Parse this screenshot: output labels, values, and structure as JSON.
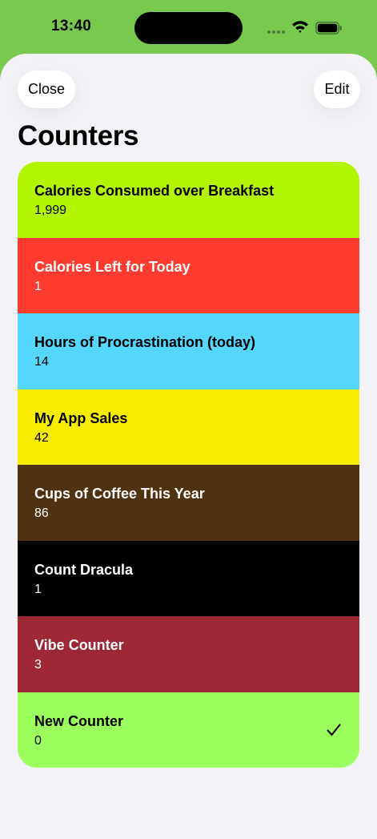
{
  "status_bar": {
    "time": "13:40"
  },
  "nav": {
    "close_label": "Close",
    "edit_label": "Edit"
  },
  "page_title": "Counters",
  "counters": [
    {
      "name": "Calories Consumed over Breakfast",
      "value": "1,999",
      "color": "#b2f500",
      "text_color": "#000000",
      "selected": false
    },
    {
      "name": "Calories Left for Today",
      "value": "1",
      "color": "#ff3b30",
      "text_color": "#ffffff",
      "selected": false
    },
    {
      "name": "Hours of Procrastination (today)",
      "value": "14",
      "color": "#55d6fc",
      "text_color": "#000000",
      "selected": false
    },
    {
      "name": "My App Sales",
      "value": "42",
      "color": "#f8ec00",
      "text_color": "#000000",
      "selected": false
    },
    {
      "name": "Cups of Coffee This Year",
      "value": "86",
      "color": "#4f3212",
      "text_color": "#ffffff",
      "selected": false
    },
    {
      "name": "Count Dracula",
      "value": "1",
      "color": "#000000",
      "text_color": "#ffffff",
      "selected": false
    },
    {
      "name": "Vibe Counter",
      "value": "3",
      "color": "#9e2835",
      "text_color": "#ffffff",
      "selected": false
    },
    {
      "name": "New Counter",
      "value": "0",
      "color": "#9bff5d",
      "text_color": "#000000",
      "selected": true
    }
  ],
  "colors": {
    "header_green": "#7ac94f",
    "sheet_background": "#f2f2f7"
  },
  "icons": {
    "selected": "checkmark-icon"
  }
}
